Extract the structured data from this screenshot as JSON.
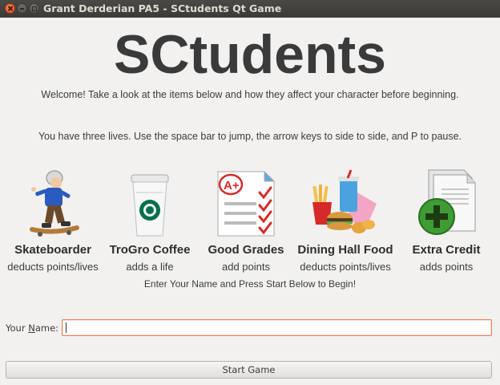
{
  "window": {
    "title": "Grant Derderian PA5 - SCtudents Qt Game",
    "controls": [
      "close-icon",
      "minimize-icon",
      "maximize-icon"
    ]
  },
  "header": {
    "title": "SCtudents",
    "welcome": "Welcome! Take a look at the items below and how they affect your character before beginning.",
    "instructions": "You have three lives. Use the space bar to jump, the arrow keys to side to side, and P to pause."
  },
  "items": [
    {
      "name": "Skateboarder",
      "effect": "deducts points/lives",
      "icon": "skateboarder-icon"
    },
    {
      "name": "TroGro Coffee",
      "effect": "adds a life",
      "icon": "coffee-cup-icon"
    },
    {
      "name": "Good Grades",
      "effect": "add points",
      "icon": "graded-paper-icon"
    },
    {
      "name": "Dining Hall Food",
      "effect": "deducts points/lives",
      "icon": "fast-food-icon"
    },
    {
      "name": "Extra Credit",
      "effect": "adds points",
      "icon": "document-plus-icon"
    }
  ],
  "prompt": "Enter Your Name and Press Start Below to Begin!",
  "form": {
    "name_label_pre": "Your ",
    "name_label_u": "N",
    "name_label_post": "ame:",
    "name_value": "",
    "start_label": "Start Game"
  },
  "colors": {
    "input_focus": "#e6855a",
    "close_button": "#df4a16",
    "titlebar": "#3c3b37"
  }
}
